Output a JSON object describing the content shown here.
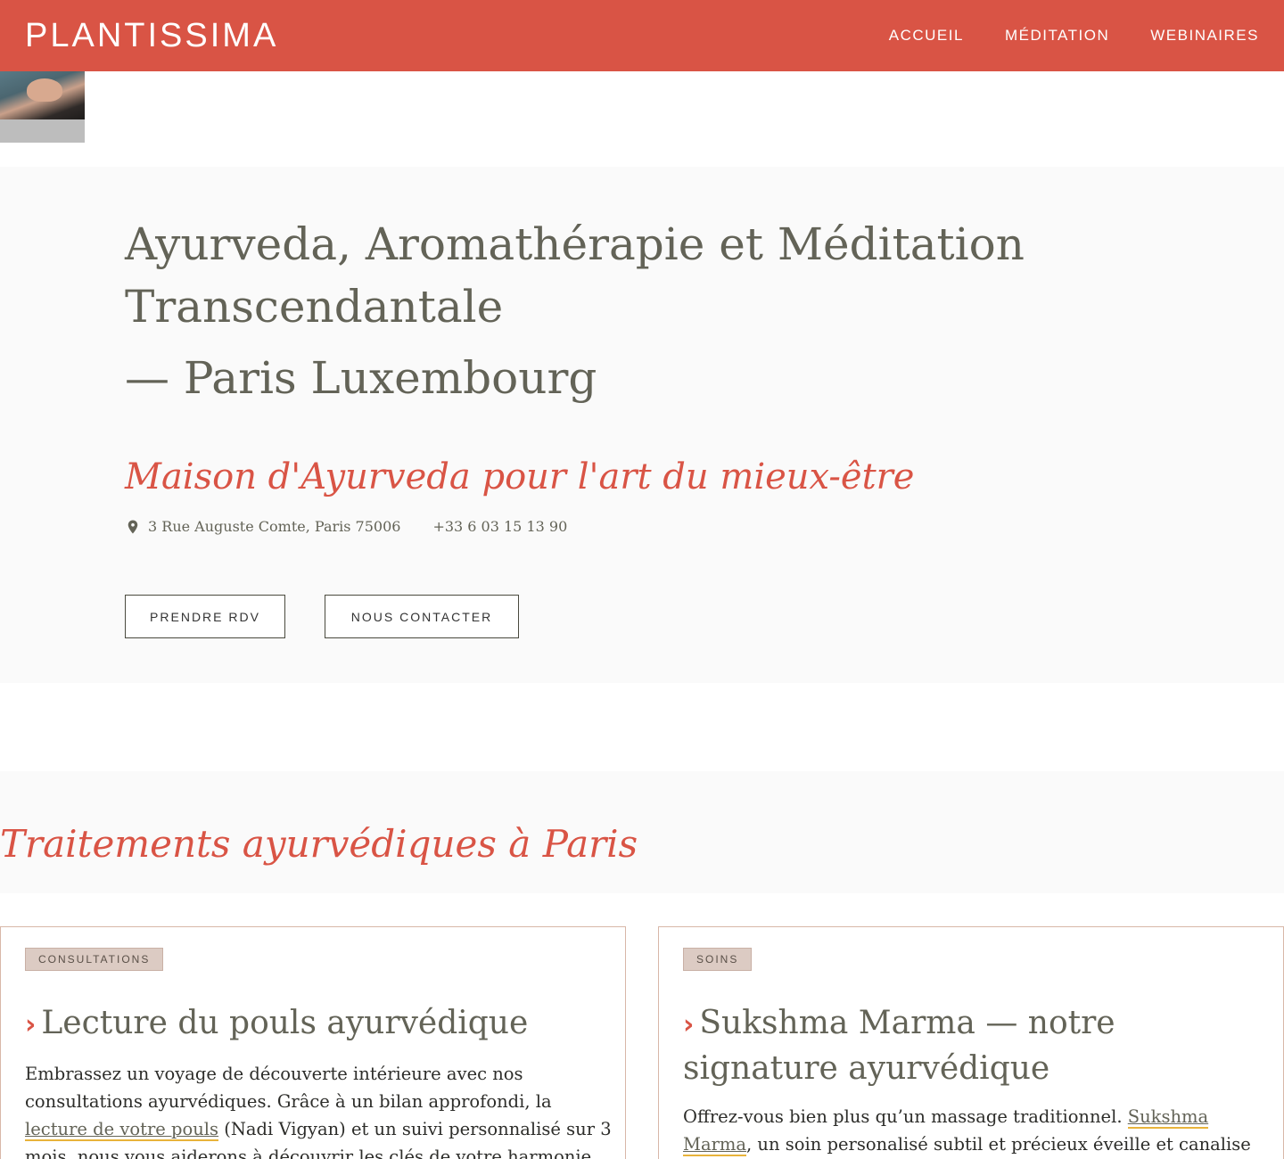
{
  "header": {
    "logo": "PLANTISSIMA",
    "nav": [
      "ACCUEIL",
      "MÉDITATION",
      "WEBINAIRES"
    ]
  },
  "hero": {
    "title": "Ayurveda, Aromathérapie et Méditation Transcendantale",
    "subtitle": "— Paris Luxembourg",
    "tagline": "Maison d'Ayurveda pour l'art du mieux-être",
    "address": "3 Rue Auguste Comte, Paris 75006",
    "phone": "+33 6 03 15 13 90",
    "buttons": {
      "appointment": "PRENDRE RDV",
      "contact": "NOUS CONTACTER"
    }
  },
  "treatments": {
    "heading": "Traitements ayurvédiques à Paris",
    "cards": [
      {
        "badge": "CONSULTATIONS",
        "title": "Lecture du pouls ayurvédique",
        "text_before": "Embrassez un voyage de découverte intérieure avec nos consultations ayurvédiques. Grâce à un bilan approfondi, la ",
        "link": "lecture de votre pouls",
        "text_after": " (Nadi Vigyan) et un suivi personnalisé sur 3 mois, nous vous aiderons à découvrir les clés de votre harmonie intérieure avec un"
      },
      {
        "badge": "SOINS",
        "title": "Sukshma Marma — notre signature ayurvédique",
        "text_before": "Offrez-vous bien plus qu’un massage traditionnel. ",
        "link": "Sukshma Marma",
        "text_after": ", un soin personalisé subtil et précieux éveille et canalise l’énergie vitale de"
      }
    ]
  },
  "colors": {
    "brand": "#d95445",
    "text": "#636357",
    "link_underline": "#e8b33a",
    "badge_bg": "#dccbc3"
  },
  "icons": {
    "location": "map-pin-icon",
    "chevron": "chevron-right-icon"
  }
}
